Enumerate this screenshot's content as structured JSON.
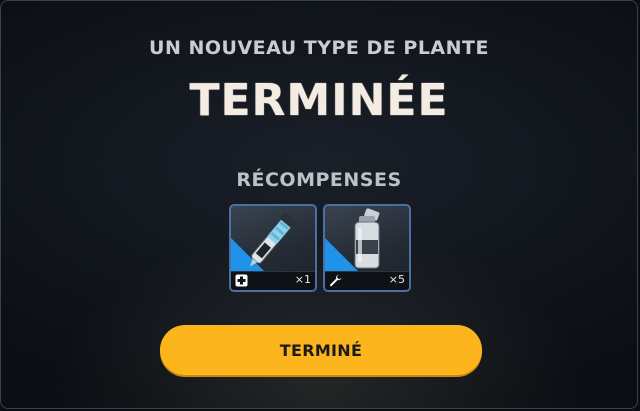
{
  "dialog": {
    "subtitle": "UN NOUVEAU TYPE DE PLANTE",
    "title": "TERMINÉE",
    "rewards_heading": "RÉCOMPENSES",
    "done_label": "TERMINÉ"
  },
  "rewards": [
    {
      "item_icon": "syringe-icon",
      "type_icon": "medical-plus-icon",
      "quantity": "×1"
    },
    {
      "item_icon": "bottle-icon",
      "type_icon": "wrench-icon",
      "quantity": "×5"
    }
  ],
  "colors": {
    "accent_button": "#fcb51d",
    "card_border": "#4a6fa3",
    "card_corner": "#1f93ea",
    "title_text": "#f4ece2"
  }
}
